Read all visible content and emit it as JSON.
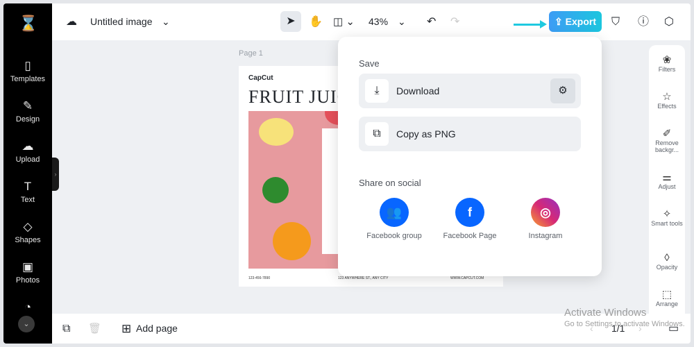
{
  "app": {
    "logo": "CapCut"
  },
  "sidebar": {
    "items": [
      {
        "label": "Templates",
        "icon": "templates-icon"
      },
      {
        "label": "Design",
        "icon": "design-icon"
      },
      {
        "label": "Upload",
        "icon": "upload-icon"
      },
      {
        "label": "Text",
        "icon": "text-icon"
      },
      {
        "label": "Shapes",
        "icon": "shapes-icon"
      },
      {
        "label": "Photos",
        "icon": "photos-icon"
      }
    ]
  },
  "header": {
    "title": "Untitled image",
    "zoom": "43%",
    "export_label": "Export"
  },
  "canvas": {
    "page_label": "Page 1",
    "brand": "CapCut",
    "title": "FRUIT JUIC",
    "footer": [
      "123-456-7890",
      "123 ANYWHERE ST., ANY CITY",
      "WWW.CAPCUT.COM"
    ]
  },
  "export_menu": {
    "save_heading": "Save",
    "download": "Download",
    "copy_png": "Copy as PNG",
    "share_heading": "Share on social",
    "social": [
      {
        "label": "Facebook group",
        "color": "#0866ff"
      },
      {
        "label": "Facebook Page",
        "color": "#0866ff"
      },
      {
        "label": "Instagram",
        "color": "#d62976"
      }
    ]
  },
  "right_panel": {
    "items": [
      "Filters",
      "Effects",
      "Remove backgr...",
      "Adjust",
      "Smart tools",
      "Opacity",
      "Arrange"
    ]
  },
  "bottom": {
    "add_page": "Add page",
    "pagination": "1/1"
  },
  "watermark": {
    "line1": "Activate Windows",
    "line2": "Go to Settings to activate Windows."
  },
  "colors": {
    "accent": "#1cc6de",
    "sidebar": "#000000"
  }
}
